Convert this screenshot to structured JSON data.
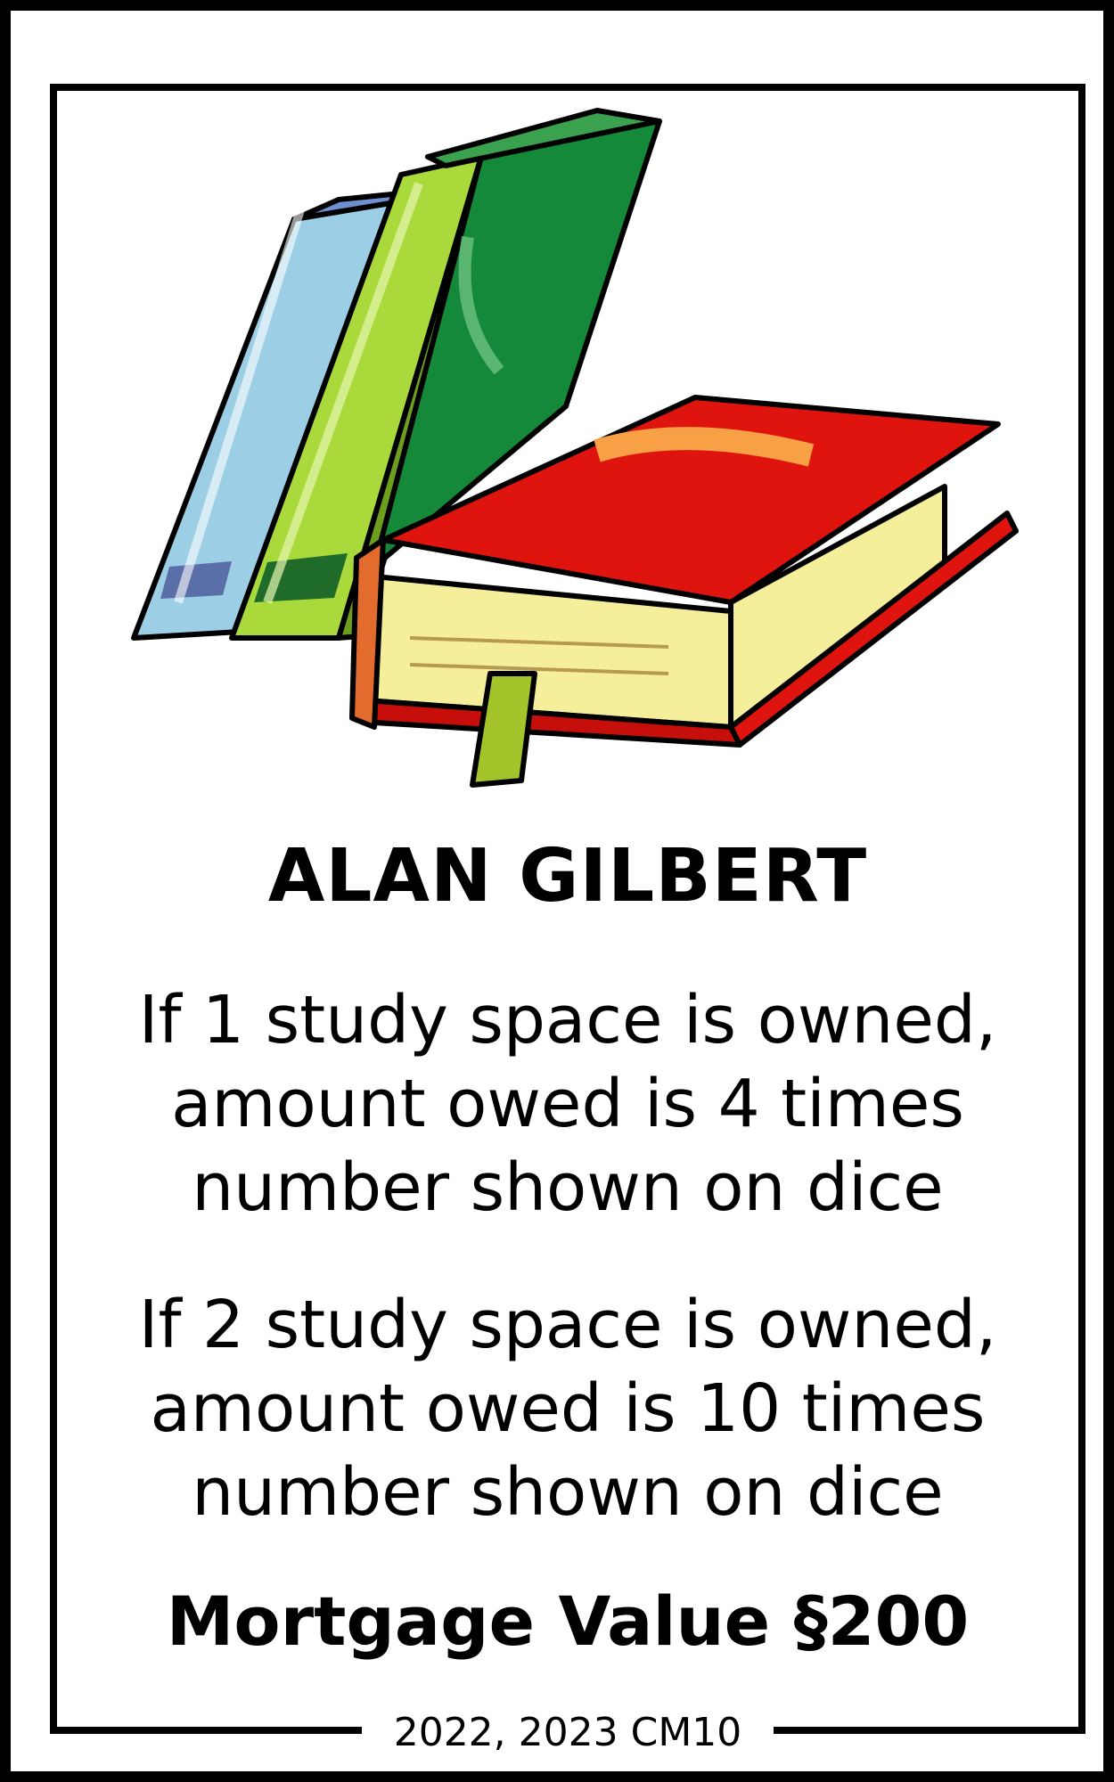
{
  "card": {
    "art_icon": "books-stack-illustration",
    "name": "ALAN GILBERT",
    "rent_rules": [
      {
        "lines": [
          "If 1 study space is owned,",
          "amount owed is 4 times",
          "number shown on dice"
        ]
      },
      {
        "lines": [
          "If 2 study space is owned,",
          "amount owed is 10 times",
          "number shown on dice"
        ]
      }
    ],
    "mortgage": "Mortgage Value §200",
    "footer": "2022, 2023 CM10"
  },
  "colors": {
    "border": "#000000",
    "background": "#ffffff",
    "book_red": "#e0140e",
    "book_dark_green": "#15893a",
    "book_light_green": "#a9d93b",
    "book_light_blue": "#9ccfe6",
    "pages_yellow": "#f5ef9c"
  }
}
